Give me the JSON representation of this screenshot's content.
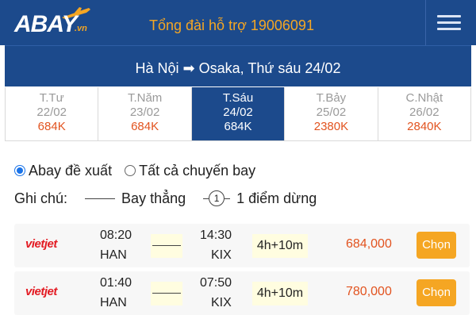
{
  "header": {
    "logo_main": "BAY",
    "logo_prefix": "A",
    "logo_suffix": ".vn",
    "hotline": "Tổng đài hỗ trợ 19006091"
  },
  "route": "Hà Nội ➡ Osaka, Thứ sáu 24/02",
  "dates": [
    {
      "day": "T.Tư",
      "date": "22/02",
      "price": "684K",
      "active": false
    },
    {
      "day": "T.Năm",
      "date": "23/02",
      "price": "684K",
      "active": false
    },
    {
      "day": "T.Sáu",
      "date": "24/02",
      "price": "684K",
      "active": true
    },
    {
      "day": "T.Bảy",
      "date": "25/02",
      "price": "2380K",
      "active": false
    },
    {
      "day": "C.Nhật",
      "date": "26/02",
      "price": "2840K",
      "active": false
    }
  ],
  "filters": {
    "recommended": "Abay đề xuất",
    "all": "Tất cả chuyến bay"
  },
  "note": {
    "label": "Ghi chú:",
    "direct": "Bay thẳng",
    "stop_num": "1",
    "one_stop": "1 điểm dừng"
  },
  "flights": [
    {
      "airline": "vietjet",
      "dep_time": "08:20",
      "dep_code": "HAN",
      "arr_time": "14:30",
      "arr_code": "KIX",
      "duration": "4h+10m",
      "price": "684,000",
      "button": "Chọn"
    },
    {
      "airline": "vietjet",
      "dep_time": "01:40",
      "dep_code": "HAN",
      "arr_time": "07:50",
      "arr_code": "KIX",
      "duration": "4h+10m",
      "price": "780,000",
      "button": "Chọn"
    }
  ],
  "colors": {
    "header_bg": "#1c4a8c",
    "accent": "#f5a623",
    "price": "#e2531f",
    "vietjet": "#e31b23"
  }
}
